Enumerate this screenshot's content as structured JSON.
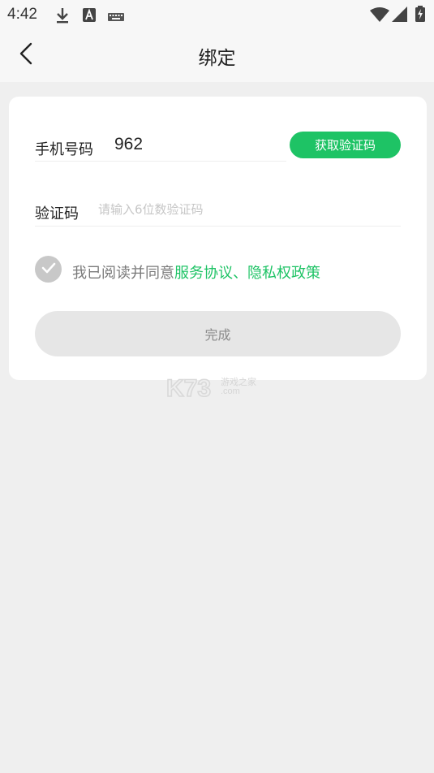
{
  "status_bar": {
    "time": "4:42"
  },
  "header": {
    "title": "绑定"
  },
  "form": {
    "phone_label": "手机号码",
    "phone_value": "962",
    "get_code_label": "获取验证码",
    "code_label": "验证码",
    "code_placeholder": "请输入6位数验证码",
    "code_value": ""
  },
  "agreement": {
    "prefix": "我已阅读并同意",
    "service_link": "服务协议",
    "separator": "、",
    "privacy_link": "隐私权政策",
    "checked": true
  },
  "done_label": "完成",
  "watermark": {
    "logo": "K73",
    "cn_text": "游戏之家",
    "com_text": ".com"
  },
  "colors": {
    "accent": "#1ec365",
    "background": "#efefef",
    "card": "#ffffff",
    "disabled_button": "#e6e6e6"
  },
  "icons": [
    "download-icon",
    "text-a-icon",
    "keyboard-icon",
    "wifi-icon",
    "signal-icon",
    "battery-charging-icon",
    "back-arrow-icon",
    "check-icon"
  ]
}
